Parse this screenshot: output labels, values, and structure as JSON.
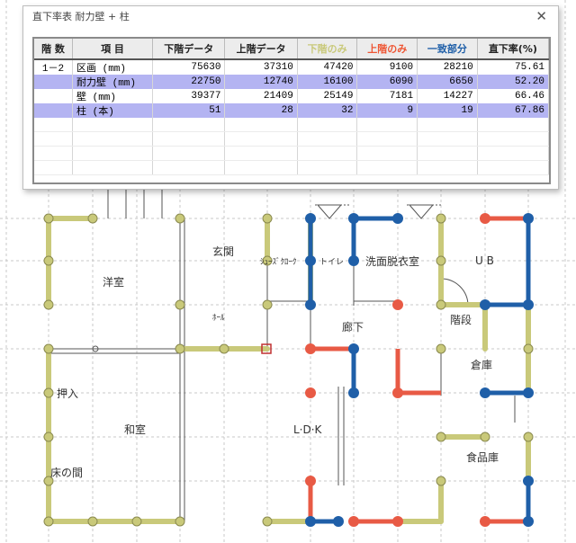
{
  "window": {
    "title": "直下率表  耐力壁 + 柱",
    "close_glyph": "✕"
  },
  "table": {
    "headers": [
      {
        "label": "階 数",
        "color": "#222222"
      },
      {
        "label": "項 目",
        "color": "#222222"
      },
      {
        "label": "下階データ",
        "color": "#222222"
      },
      {
        "label": "上階データ",
        "color": "#222222"
      },
      {
        "label": "下階のみ",
        "color": "#c9c97a"
      },
      {
        "label": "上階のみ",
        "color": "#ee5533"
      },
      {
        "label": "一致部分",
        "color": "#1f5fa8"
      },
      {
        "label": "直下率(%)",
        "color": "#222222"
      }
    ],
    "rows": [
      {
        "floor": "1－2",
        "item": "区画  (mm)",
        "lower": "75630",
        "upper": "37310",
        "lower_only": "47420",
        "upper_only": "9100",
        "match": "28210",
        "ratio": "75.61",
        "selected": false
      },
      {
        "floor": "",
        "item": "耐力壁 (mm)",
        "lower": "22750",
        "upper": "12740",
        "lower_only": "16100",
        "upper_only": "6090",
        "match": "6650",
        "ratio": "52.20",
        "selected": true
      },
      {
        "floor": "",
        "item": "壁   (mm)",
        "lower": "39377",
        "upper": "21409",
        "lower_only": "25149",
        "upper_only": "7181",
        "match": "14227",
        "ratio": "66.46",
        "selected": false
      },
      {
        "floor": "",
        "item": "柱   (本)",
        "lower": "51",
        "upper": "28",
        "lower_only": "32",
        "upper_only": "9",
        "match": "19",
        "ratio": "67.86",
        "selected": true
      }
    ],
    "empty_rows": 4
  },
  "plan": {
    "rooms": [
      {
        "label": "玄関",
        "size": "normal"
      },
      {
        "label": "ｼｭｰｽﾞｸﾛｰｸ",
        "size": "small"
      },
      {
        "label": "トイレ",
        "size": "small"
      },
      {
        "label": "洗面脱衣室",
        "size": "normal"
      },
      {
        "label": "U B",
        "size": "normal"
      },
      {
        "label": "洋室",
        "size": "normal"
      },
      {
        "label": "ﾎｰﾙ",
        "size": "small"
      },
      {
        "label": "廊下",
        "size": "normal"
      },
      {
        "label": "階段",
        "size": "normal"
      },
      {
        "label": "倉庫",
        "size": "normal"
      },
      {
        "label": "押入",
        "size": "normal"
      },
      {
        "label": "和室",
        "size": "normal"
      },
      {
        "label": "L·D·K",
        "size": "normal"
      },
      {
        "label": "食品庫",
        "size": "normal"
      },
      {
        "label": "床の間",
        "size": "normal"
      }
    ],
    "colors": {
      "lower_only": "#c9c97a",
      "upper_only": "#e85a45",
      "match": "#1f5fa8"
    }
  }
}
